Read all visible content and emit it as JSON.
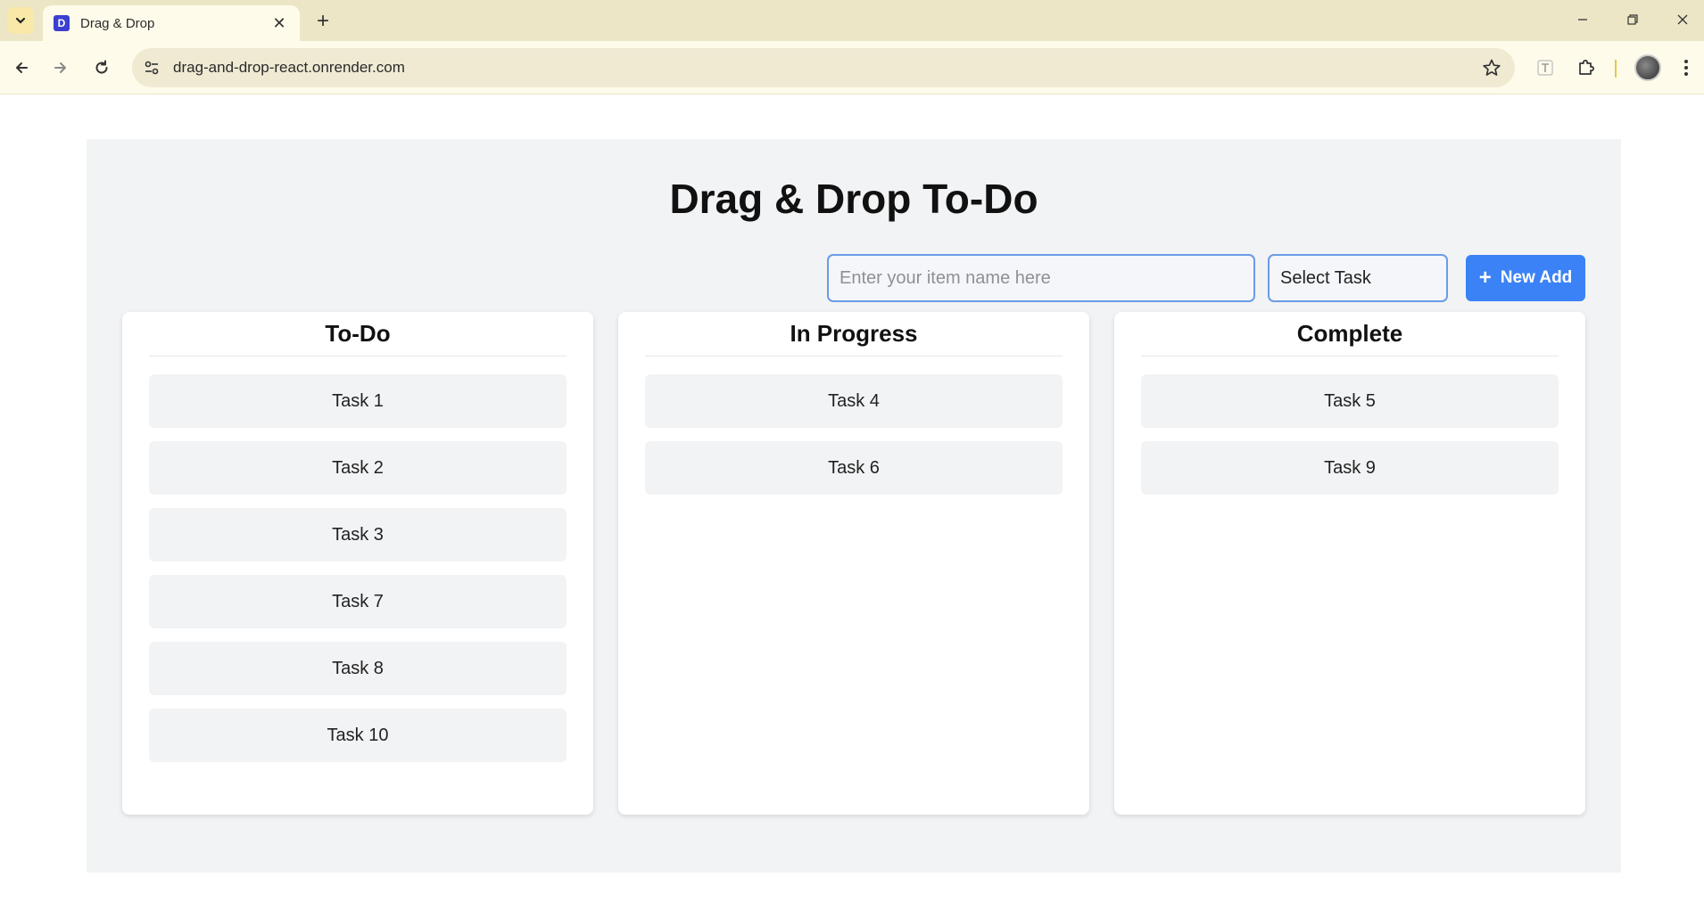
{
  "browser": {
    "tab_title": "Drag & Drop",
    "favicon_letter": "D",
    "url": "drag-and-drop-react.onrender.com",
    "icons": {
      "tab_search": "chevron-down-icon",
      "tab_close": "close-icon",
      "new_tab": "plus-icon",
      "minimize": "minimize-icon",
      "restore": "restore-icon",
      "close_window": "close-icon",
      "back": "back-arrow-icon",
      "forward": "forward-arrow-icon",
      "reload": "reload-icon",
      "site_info": "tune-icon",
      "bookmark": "star-icon",
      "extension_t": "translate-icon",
      "extensions": "puzzle-icon",
      "profile": "avatar",
      "menu": "kebab-menu-icon"
    }
  },
  "app": {
    "title": "Drag & Drop To-Do",
    "input_placeholder": "Enter your item name here",
    "input_value": "",
    "select_value": "Select Task",
    "add_button_label": "New Add",
    "add_button_icon": "+",
    "accent_color": "#3b82f6",
    "columns": [
      {
        "title": "To-Do",
        "tasks": [
          "Task 1",
          "Task 2",
          "Task 3",
          "Task 7",
          "Task 8",
          "Task 10"
        ]
      },
      {
        "title": "In Progress",
        "tasks": [
          "Task 4",
          "Task 6"
        ]
      },
      {
        "title": "Complete",
        "tasks": [
          "Task 5",
          "Task 9"
        ]
      }
    ]
  }
}
